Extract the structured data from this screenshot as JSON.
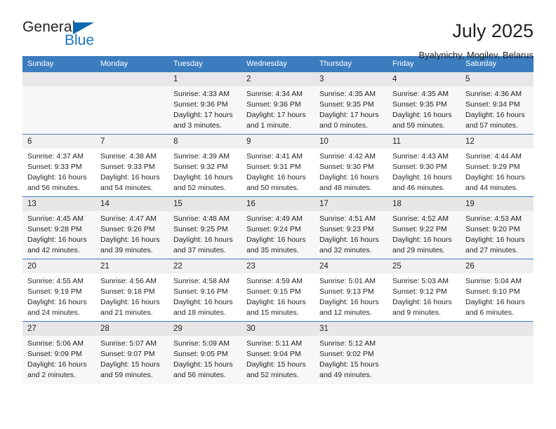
{
  "logo": {
    "general_text": "General",
    "blue_text": "Blue",
    "triangle_color": "#1068b0",
    "blue_color": "#1b75bb"
  },
  "header": {
    "title": "July 2025",
    "subtitle": "Byalynichy, Mogilev, Belarus"
  },
  "theme": {
    "header_bg": "#3c7dbf",
    "header_text": "#ffffff",
    "daynum_bg": "#f0f0f0",
    "alt_row_bg": "#f7f7f7",
    "text": "#231f20"
  },
  "weekday_headers": [
    "Sunday",
    "Monday",
    "Tuesday",
    "Wednesday",
    "Thursday",
    "Friday",
    "Saturday"
  ],
  "weeks": [
    [
      {
        "day": "",
        "sunrise": "",
        "sunset": "",
        "daylight_1": "",
        "daylight_2": ""
      },
      {
        "day": "",
        "sunrise": "",
        "sunset": "",
        "daylight_1": "",
        "daylight_2": ""
      },
      {
        "day": "1",
        "sunrise": "Sunrise: 4:33 AM",
        "sunset": "Sunset: 9:36 PM",
        "daylight_1": "Daylight: 17 hours",
        "daylight_2": "and 3 minutes."
      },
      {
        "day": "2",
        "sunrise": "Sunrise: 4:34 AM",
        "sunset": "Sunset: 9:36 PM",
        "daylight_1": "Daylight: 17 hours",
        "daylight_2": "and 1 minute."
      },
      {
        "day": "3",
        "sunrise": "Sunrise: 4:35 AM",
        "sunset": "Sunset: 9:35 PM",
        "daylight_1": "Daylight: 17 hours",
        "daylight_2": "and 0 minutes."
      },
      {
        "day": "4",
        "sunrise": "Sunrise: 4:35 AM",
        "sunset": "Sunset: 9:35 PM",
        "daylight_1": "Daylight: 16 hours",
        "daylight_2": "and 59 minutes."
      },
      {
        "day": "5",
        "sunrise": "Sunrise: 4:36 AM",
        "sunset": "Sunset: 9:34 PM",
        "daylight_1": "Daylight: 16 hours",
        "daylight_2": "and 57 minutes."
      }
    ],
    [
      {
        "day": "6",
        "sunrise": "Sunrise: 4:37 AM",
        "sunset": "Sunset: 9:33 PM",
        "daylight_1": "Daylight: 16 hours",
        "daylight_2": "and 56 minutes."
      },
      {
        "day": "7",
        "sunrise": "Sunrise: 4:38 AM",
        "sunset": "Sunset: 9:33 PM",
        "daylight_1": "Daylight: 16 hours",
        "daylight_2": "and 54 minutes."
      },
      {
        "day": "8",
        "sunrise": "Sunrise: 4:39 AM",
        "sunset": "Sunset: 9:32 PM",
        "daylight_1": "Daylight: 16 hours",
        "daylight_2": "and 52 minutes."
      },
      {
        "day": "9",
        "sunrise": "Sunrise: 4:41 AM",
        "sunset": "Sunset: 9:31 PM",
        "daylight_1": "Daylight: 16 hours",
        "daylight_2": "and 50 minutes."
      },
      {
        "day": "10",
        "sunrise": "Sunrise: 4:42 AM",
        "sunset": "Sunset: 9:30 PM",
        "daylight_1": "Daylight: 16 hours",
        "daylight_2": "and 48 minutes."
      },
      {
        "day": "11",
        "sunrise": "Sunrise: 4:43 AM",
        "sunset": "Sunset: 9:30 PM",
        "daylight_1": "Daylight: 16 hours",
        "daylight_2": "and 46 minutes."
      },
      {
        "day": "12",
        "sunrise": "Sunrise: 4:44 AM",
        "sunset": "Sunset: 9:29 PM",
        "daylight_1": "Daylight: 16 hours",
        "daylight_2": "and 44 minutes."
      }
    ],
    [
      {
        "day": "13",
        "sunrise": "Sunrise: 4:45 AM",
        "sunset": "Sunset: 9:28 PM",
        "daylight_1": "Daylight: 16 hours",
        "daylight_2": "and 42 minutes."
      },
      {
        "day": "14",
        "sunrise": "Sunrise: 4:47 AM",
        "sunset": "Sunset: 9:26 PM",
        "daylight_1": "Daylight: 16 hours",
        "daylight_2": "and 39 minutes."
      },
      {
        "day": "15",
        "sunrise": "Sunrise: 4:48 AM",
        "sunset": "Sunset: 9:25 PM",
        "daylight_1": "Daylight: 16 hours",
        "daylight_2": "and 37 minutes."
      },
      {
        "day": "16",
        "sunrise": "Sunrise: 4:49 AM",
        "sunset": "Sunset: 9:24 PM",
        "daylight_1": "Daylight: 16 hours",
        "daylight_2": "and 35 minutes."
      },
      {
        "day": "17",
        "sunrise": "Sunrise: 4:51 AM",
        "sunset": "Sunset: 9:23 PM",
        "daylight_1": "Daylight: 16 hours",
        "daylight_2": "and 32 minutes."
      },
      {
        "day": "18",
        "sunrise": "Sunrise: 4:52 AM",
        "sunset": "Sunset: 9:22 PM",
        "daylight_1": "Daylight: 16 hours",
        "daylight_2": "and 29 minutes."
      },
      {
        "day": "19",
        "sunrise": "Sunrise: 4:53 AM",
        "sunset": "Sunset: 9:20 PM",
        "daylight_1": "Daylight: 16 hours",
        "daylight_2": "and 27 minutes."
      }
    ],
    [
      {
        "day": "20",
        "sunrise": "Sunrise: 4:55 AM",
        "sunset": "Sunset: 9:19 PM",
        "daylight_1": "Daylight: 16 hours",
        "daylight_2": "and 24 minutes."
      },
      {
        "day": "21",
        "sunrise": "Sunrise: 4:56 AM",
        "sunset": "Sunset: 9:18 PM",
        "daylight_1": "Daylight: 16 hours",
        "daylight_2": "and 21 minutes."
      },
      {
        "day": "22",
        "sunrise": "Sunrise: 4:58 AM",
        "sunset": "Sunset: 9:16 PM",
        "daylight_1": "Daylight: 16 hours",
        "daylight_2": "and 18 minutes."
      },
      {
        "day": "23",
        "sunrise": "Sunrise: 4:59 AM",
        "sunset": "Sunset: 9:15 PM",
        "daylight_1": "Daylight: 16 hours",
        "daylight_2": "and 15 minutes."
      },
      {
        "day": "24",
        "sunrise": "Sunrise: 5:01 AM",
        "sunset": "Sunset: 9:13 PM",
        "daylight_1": "Daylight: 16 hours",
        "daylight_2": "and 12 minutes."
      },
      {
        "day": "25",
        "sunrise": "Sunrise: 5:03 AM",
        "sunset": "Sunset: 9:12 PM",
        "daylight_1": "Daylight: 16 hours",
        "daylight_2": "and 9 minutes."
      },
      {
        "day": "26",
        "sunrise": "Sunrise: 5:04 AM",
        "sunset": "Sunset: 9:10 PM",
        "daylight_1": "Daylight: 16 hours",
        "daylight_2": "and 6 minutes."
      }
    ],
    [
      {
        "day": "27",
        "sunrise": "Sunrise: 5:06 AM",
        "sunset": "Sunset: 9:09 PM",
        "daylight_1": "Daylight: 16 hours",
        "daylight_2": "and 2 minutes."
      },
      {
        "day": "28",
        "sunrise": "Sunrise: 5:07 AM",
        "sunset": "Sunset: 9:07 PM",
        "daylight_1": "Daylight: 15 hours",
        "daylight_2": "and 59 minutes."
      },
      {
        "day": "29",
        "sunrise": "Sunrise: 5:09 AM",
        "sunset": "Sunset: 9:05 PM",
        "daylight_1": "Daylight: 15 hours",
        "daylight_2": "and 56 minutes."
      },
      {
        "day": "30",
        "sunrise": "Sunrise: 5:11 AM",
        "sunset": "Sunset: 9:04 PM",
        "daylight_1": "Daylight: 15 hours",
        "daylight_2": "and 52 minutes."
      },
      {
        "day": "31",
        "sunrise": "Sunrise: 5:12 AM",
        "sunset": "Sunset: 9:02 PM",
        "daylight_1": "Daylight: 15 hours",
        "daylight_2": "and 49 minutes."
      },
      {
        "day": "",
        "sunrise": "",
        "sunset": "",
        "daylight_1": "",
        "daylight_2": ""
      },
      {
        "day": "",
        "sunrise": "",
        "sunset": "",
        "daylight_1": "",
        "daylight_2": ""
      }
    ]
  ]
}
